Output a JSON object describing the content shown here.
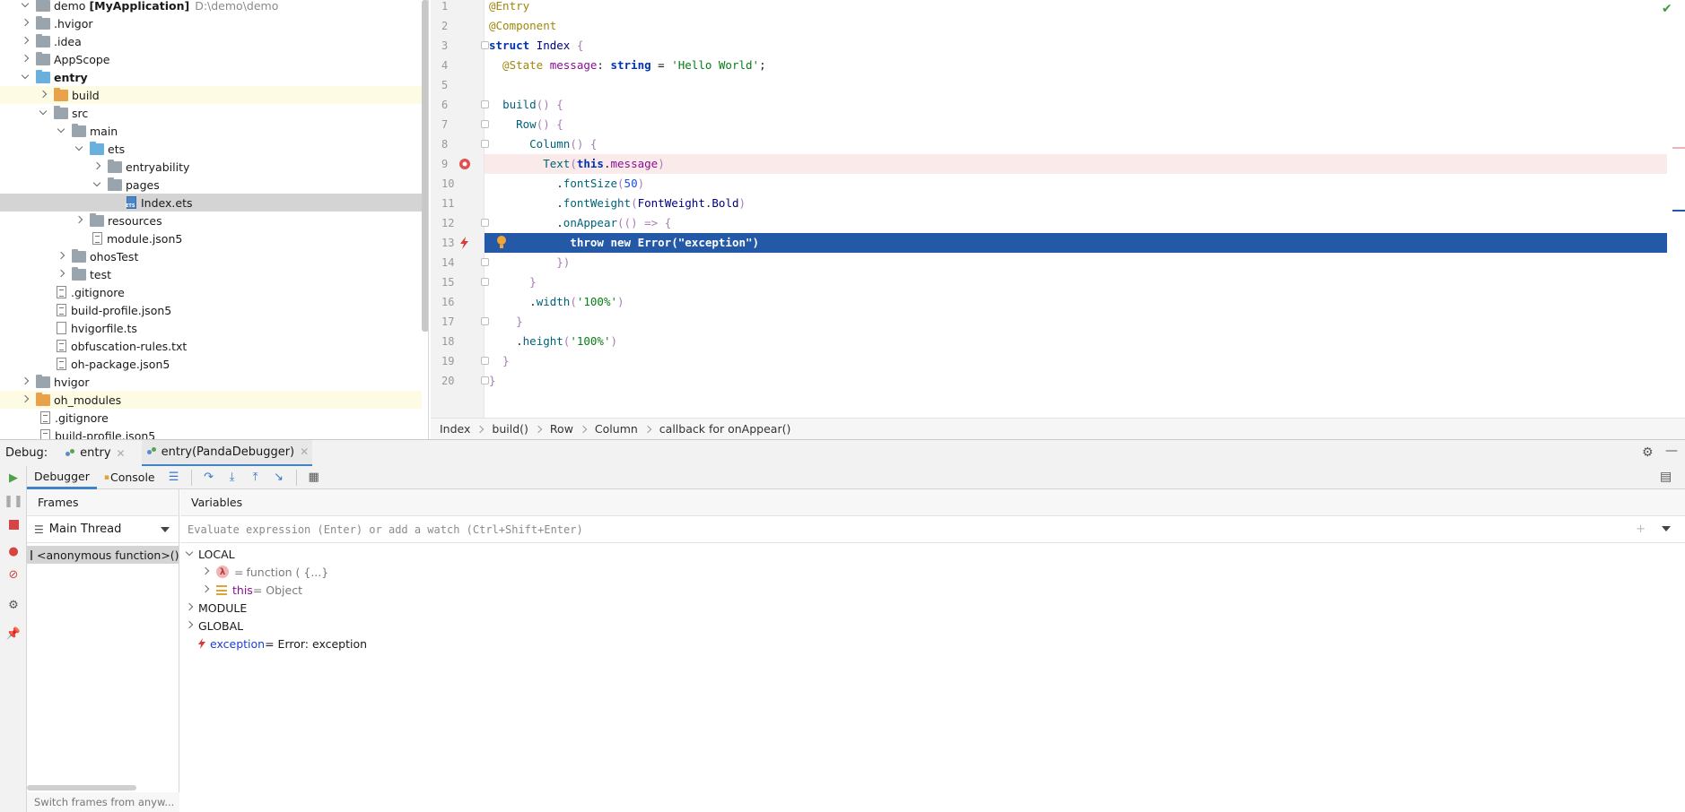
{
  "project": {
    "root_name": "demo",
    "root_module": "[MyApplication]",
    "root_path": "D:\\demo\\demo",
    "items": [
      {
        "label": ".hvigor"
      },
      {
        "label": ".idea"
      },
      {
        "label": "AppScope"
      },
      {
        "label": "entry"
      },
      {
        "label": "build"
      },
      {
        "label": "src"
      },
      {
        "label": "main"
      },
      {
        "label": "ets"
      },
      {
        "label": "entryability"
      },
      {
        "label": "pages"
      },
      {
        "label": "Index.ets"
      },
      {
        "label": "resources"
      },
      {
        "label": "module.json5"
      },
      {
        "label": "ohosTest"
      },
      {
        "label": "test"
      },
      {
        "label": ".gitignore"
      },
      {
        "label": "build-profile.json5"
      },
      {
        "label": "hvigorfile.ts"
      },
      {
        "label": "obfuscation-rules.txt"
      },
      {
        "label": "oh-package.json5"
      },
      {
        "label": "hvigor"
      },
      {
        "label": "oh_modules"
      },
      {
        "label": ".gitignore"
      },
      {
        "label": "build-profile.json5"
      }
    ]
  },
  "editor": {
    "line_numbers": [
      "1",
      "2",
      "3",
      "4",
      "5",
      "6",
      "7",
      "8",
      "9",
      "10",
      "11",
      "12",
      "13",
      "14",
      "15",
      "16",
      "17",
      "18",
      "19",
      "20"
    ],
    "lines": {
      "l1": "@Entry",
      "l2": "@Component",
      "l3a": "struct ",
      "l3b": "Index",
      "l3c": " {",
      "l4a": "  @State ",
      "l4b": "message",
      "l4c": ": ",
      "l4d": "string",
      "l4e": " = ",
      "l4f": "'Hello World'",
      "l4g": ";",
      "l6a": "  ",
      "l6b": "build",
      "l6c": "() {",
      "l7a": "    ",
      "l7b": "Row",
      "l7c": "() {",
      "l8a": "      ",
      "l8b": "Column",
      "l8c": "() {",
      "l9a": "        ",
      "l9b": "Text",
      "l9c": "(",
      "l9d": "this",
      "l9e": ".",
      "l9f": "message",
      "l9g": ")",
      "l10a": "          .",
      "l10b": "fontSize",
      "l10c": "(",
      "l10d": "50",
      "l10e": ")",
      "l11a": "          .",
      "l11b": "fontWeight",
      "l11c": "(",
      "l11d": "FontWeight",
      "l11e": ".",
      "l11f": "Bold",
      "l11g": ")",
      "l12a": "          .",
      "l12b": "onAppear",
      "l12c": "(() => {",
      "l13a": "            throw new ",
      "l13b": "Error",
      "l13c": "(",
      "l13d": "\"exception\"",
      "l13e": ")",
      "l14": "          })",
      "l15": "      }",
      "l16a": "      .",
      "l16b": "width",
      "l16c": "(",
      "l16d": "'100%'",
      "l16e": ")",
      "l17": "    }",
      "l18a": "    .",
      "l18b": "height",
      "l18c": "(",
      "l18d": "'100%'",
      "l18e": ")",
      "l19": "  }",
      "l20": "}"
    }
  },
  "breadcrumb": [
    "Index",
    "build()",
    "Row",
    "Column",
    "callback for onAppear()"
  ],
  "debug": {
    "label": "Debug:",
    "tabs": [
      {
        "label": "entry"
      },
      {
        "label": "entry(PandaDebugger)"
      }
    ],
    "subtabs": {
      "debugger": "Debugger",
      "console": "Console"
    },
    "frames_title": "Frames",
    "thread": "Main Thread",
    "frame_item": "<anonymous function>(),",
    "frames_footer": "Switch frames from anyw...",
    "variables_title": "Variables",
    "eval_placeholder": "Evaluate expression (Enter) or add a watch (Ctrl+Shift+Enter)",
    "vars": {
      "local": "LOCAL",
      "fn_eq": "= ",
      "fn_val": "function ( {...}",
      "this_name": "this",
      "this_val": " = Object",
      "module": "MODULE",
      "global": "GLOBAL",
      "exc_name": "exception",
      "exc_val": " = Error: exception"
    }
  },
  "colors": {
    "accent": "#2459a8",
    "breakpoint": "#e05050",
    "exception": "#d63c3c"
  }
}
